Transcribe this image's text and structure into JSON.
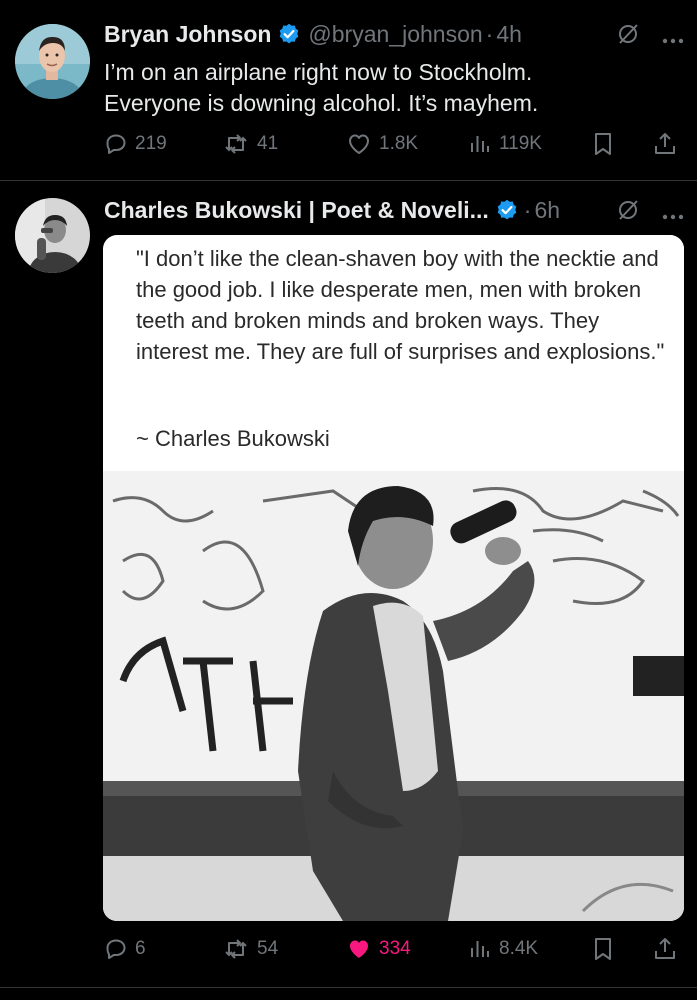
{
  "tweets": [
    {
      "author_name": "Bryan Johnson",
      "handle": "@bryan_johnson",
      "separator": "·",
      "time": "4h",
      "text_lines": [
        "I’m on an airplane right now to Stockholm.",
        "Everyone is downing alcohol. It’s mayhem."
      ],
      "replies": "219",
      "reposts": "41",
      "likes": "1.8K",
      "views": "119K",
      "liked": false
    },
    {
      "author_name": "Charles Bukowski | Poet & Noveli...",
      "separator": "·",
      "time": "6h",
      "quote_image": {
        "quote": "\"I don’t like the clean-shaven boy with the necktie and the good job. I like desperate men, men with broken teeth and broken minds and broken ways. They interest me. They are full of surprises and explosions.\"",
        "attribution": "~ Charles Bukowski"
      },
      "replies": "6",
      "reposts": "54",
      "likes": "334",
      "views": "8.4K",
      "liked": true
    }
  ],
  "icons": {
    "verified": "verified-badge-icon",
    "grok": "grok-icon",
    "more": "more-icon",
    "reply": "reply-icon",
    "repost": "repost-icon",
    "like": "like-icon",
    "views": "views-icon",
    "bookmark": "bookmark-icon",
    "share": "share-icon"
  },
  "colors": {
    "background": "#000000",
    "text": "#e7e9ea",
    "muted": "#71767b",
    "verified": "#1d9bf0",
    "like_active": "#f91880",
    "divider": "#2f3336"
  }
}
